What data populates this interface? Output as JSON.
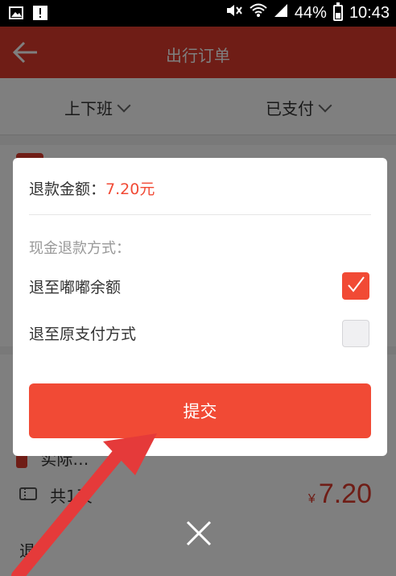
{
  "status_bar": {
    "battery": "44%",
    "time": "10:43",
    "icons": [
      "image-icon",
      "alert-icon",
      "mute-icon",
      "wifi-icon",
      "signal-icon",
      "battery-icon"
    ]
  },
  "header": {
    "title": "出行订单",
    "back_icon": "back-arrow-icon"
  },
  "filters": {
    "left": "上下班",
    "right": "已支付"
  },
  "background": {
    "row_days": "共1天",
    "row_partial": "实际…",
    "bottom_partial": "退",
    "price_currency": "¥",
    "price_value": "7.20"
  },
  "dialog": {
    "refund_label": "退款金额：",
    "refund_amount": "7.20元",
    "section_title": "现金退款方式：",
    "options": [
      {
        "label": "退至嘟嘟余额",
        "checked": true
      },
      {
        "label": "退至原支付方式",
        "checked": false
      }
    ],
    "submit_label": "提交"
  },
  "close_icon": "close-icon",
  "colors": {
    "accent": "#f14a35",
    "header": "#de3a2c",
    "overlay_arrow": "#e53a3a"
  }
}
